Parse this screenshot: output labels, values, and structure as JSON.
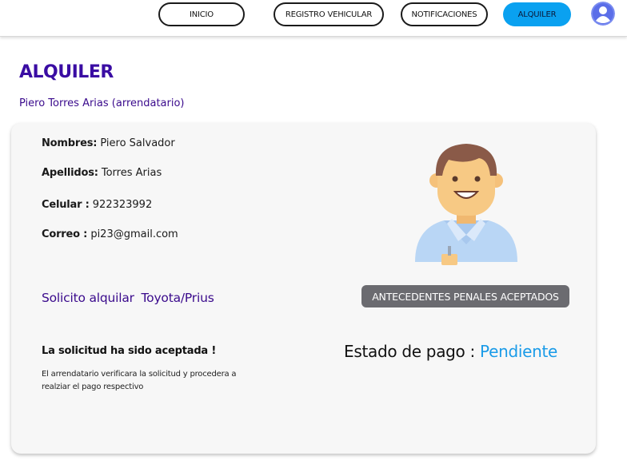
{
  "nav": {
    "inicio": "INICIO",
    "registro": "REGISTRO VEHICULAR",
    "notificaciones": "NOTIFICACIONES",
    "alquiler": "ALQUILER"
  },
  "page": {
    "title": "ALQUILER",
    "subtitle": "Piero Torres Arias (arrendatario)"
  },
  "tenant": {
    "nombres_label": "Nombres:",
    "nombres": "Piero Salvador",
    "apellidos_label": "Apellidos:",
    "apellidos": "Torres Arias",
    "celular_label": "Celular :",
    "celular": "922323992",
    "correo_label": "Correo :",
    "correo": "pi23@gmail.com"
  },
  "request": {
    "text": "Solicito alquilar",
    "vehicle": "Toyota/Prius"
  },
  "antecedentes": "ANTECEDENTES PENALES  ACEPTADOS",
  "status": {
    "accepted": "La solicitud ha sido aceptada !",
    "note": "El arrendatario verificara la solicitud y procedera a realziar el pago respectivo",
    "estado_label": "Estado de pago :",
    "estado_value": "Pendiente"
  },
  "colors": {
    "title_purple": "#3a0ca3",
    "subtitle_purple": "#3a0a8c",
    "accent_blue": "#0aa1f0",
    "status_blue": "#1a9be8",
    "badge_gray": "#6b6b70",
    "nav_active": "#0aa1f0"
  },
  "icons": {
    "avatar": "user-avatar-icon",
    "profile": "person-illustration"
  }
}
